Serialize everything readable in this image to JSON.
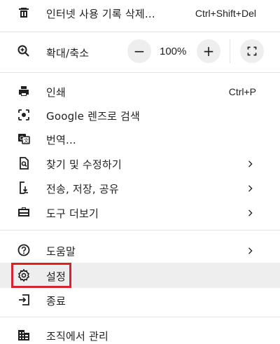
{
  "menu": {
    "clear_history": {
      "label": "인터넷 사용 기록 삭제...",
      "shortcut": "Ctrl+Shift+Del",
      "icon": "trash-icon"
    },
    "zoom": {
      "label": "확대/축소",
      "value": "100%",
      "minus": "−",
      "plus": "+",
      "icon": "zoom-icon"
    },
    "print": {
      "label": "인쇄",
      "shortcut": "Ctrl+P",
      "icon": "printer-icon"
    },
    "lens": {
      "label": "Google 렌즈로 검색",
      "icon": "lens-icon"
    },
    "translate": {
      "label": "번역...",
      "icon": "translate-icon"
    },
    "find_edit": {
      "label": "찾기 및 수정하기",
      "icon": "find-icon"
    },
    "cast_save_share": {
      "label": "전송, 저장, 공유",
      "icon": "save-share-icon"
    },
    "more_tools": {
      "label": "도구 더보기",
      "icon": "toolbox-icon"
    },
    "help": {
      "label": "도움말",
      "icon": "help-icon"
    },
    "settings": {
      "label": "설정",
      "icon": "gear-icon"
    },
    "exit": {
      "label": "종료",
      "icon": "exit-icon"
    },
    "managed": {
      "label": "조직에서 관리",
      "icon": "building-icon"
    }
  },
  "highlight_color": "#d9232a"
}
